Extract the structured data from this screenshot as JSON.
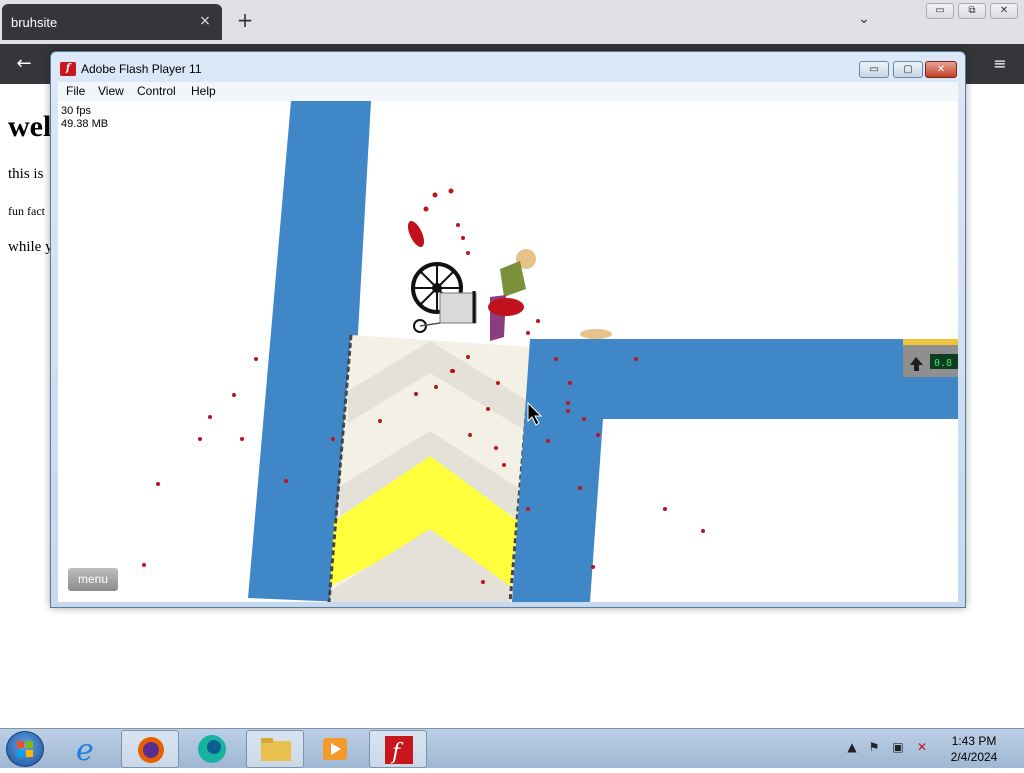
{
  "browser": {
    "tab_title": "bruhsite",
    "tab_close_icon": "×",
    "new_tab_icon": "+",
    "tab_list_icon": "⌄",
    "back_icon": "←",
    "menu_icon": "≡",
    "window_controls": {
      "minimize": "▭",
      "restore": "⧉",
      "close": "✕"
    }
  },
  "page": {
    "heading": "wel",
    "line1": "this is",
    "line2": "fun fact",
    "line3": "while y"
  },
  "flash": {
    "title": "Adobe Flash Player 11",
    "icon_letter": "f",
    "menu": [
      "File",
      "View",
      "Control",
      "Help"
    ],
    "fps": "30 fps",
    "memory": "49.38 MB",
    "menu_button": "menu",
    "window_controls": {
      "minimize": "▭",
      "maximize": "▢",
      "close": "✕"
    },
    "colors": {
      "blue": "#3f87c6",
      "yellow": "#fefe3c",
      "cream": "#f3f1e6",
      "blood": "#c0121c"
    },
    "sign_text": "0.8"
  },
  "taskbar": {
    "time": "1:43 PM",
    "date": "2/4/2024",
    "apps": [
      "internet-explorer",
      "firefox",
      "edge",
      "file-explorer",
      "media-player",
      "flash-player"
    ]
  }
}
